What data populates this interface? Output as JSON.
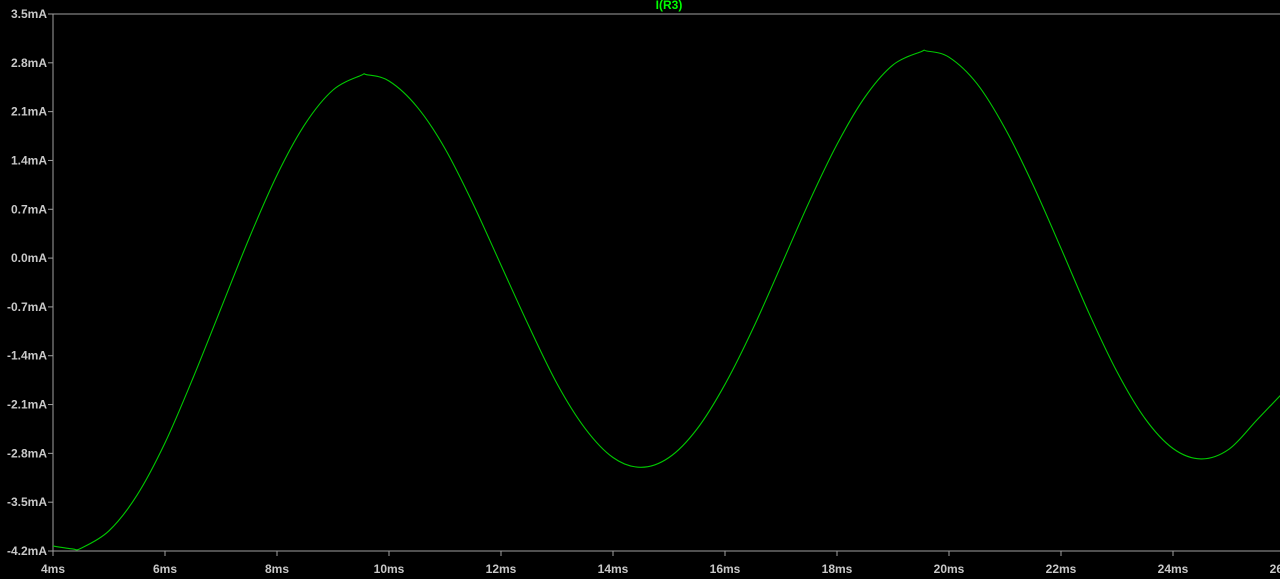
{
  "chart_data": {
    "type": "line",
    "title": "I(R3)",
    "xlabel": "",
    "ylabel": "",
    "xlim": [
      4,
      26
    ],
    "ylim": [
      -4.2,
      3.5
    ],
    "x_unit": "ms",
    "y_unit": "mA",
    "grid": false,
    "x_ticks": [
      "4ms",
      "6ms",
      "8ms",
      "10ms",
      "12ms",
      "14ms",
      "16ms",
      "18ms",
      "20ms",
      "22ms",
      "24ms",
      "26ms"
    ],
    "x_tick_values": [
      4,
      6,
      8,
      10,
      12,
      14,
      16,
      18,
      20,
      22,
      24,
      26
    ],
    "y_ticks": [
      "3.5mA",
      "2.8mA",
      "2.1mA",
      "1.4mA",
      "0.7mA",
      "0.0mA",
      "-0.7mA",
      "-1.4mA",
      "-2.1mA",
      "-2.8mA",
      "-3.5mA",
      "-4.2mA"
    ],
    "y_tick_values": [
      3.5,
      2.8,
      2.1,
      1.4,
      0.7,
      0.0,
      -0.7,
      -1.4,
      -2.1,
      -2.8,
      -3.5,
      -4.2
    ],
    "series": [
      {
        "name": "I(R3)",
        "color": "#00c800",
        "x": [
          4,
          4.35,
          4.5,
          5,
          5.5,
          6,
          6.5,
          7,
          7.5,
          8,
          8.5,
          9,
          9.5,
          9.6,
          10,
          10.5,
          11,
          11.5,
          12,
          12.5,
          13,
          13.5,
          14,
          14.5,
          15,
          15.5,
          16,
          16.5,
          17,
          17.5,
          18,
          18.5,
          19,
          19.5,
          19.6,
          20,
          20.5,
          21,
          21.5,
          22,
          22.5,
          23,
          23.5,
          24,
          24.5,
          25,
          25.5,
          26
        ],
        "y": [
          -4.13,
          -4.17,
          -4.16,
          -3.91,
          -3.4,
          -2.65,
          -1.72,
          -0.72,
          0.28,
          1.19,
          1.92,
          2.41,
          2.62,
          2.63,
          2.54,
          2.17,
          1.57,
          0.78,
          -0.1,
          -0.98,
          -1.8,
          -2.44,
          -2.86,
          -3.0,
          -2.86,
          -2.45,
          -1.81,
          -1.01,
          -0.11,
          0.8,
          1.63,
          2.31,
          2.77,
          2.96,
          2.97,
          2.88,
          2.5,
          1.86,
          1.05,
          0.14,
          -0.79,
          -1.63,
          -2.3,
          -2.73,
          -2.88,
          -2.74,
          -2.32,
          -1.9
        ]
      }
    ]
  }
}
